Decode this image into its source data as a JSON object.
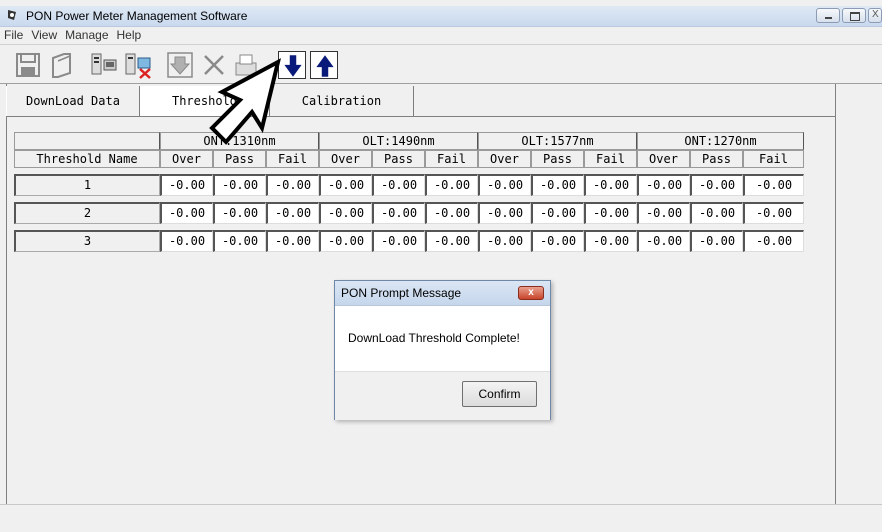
{
  "window": {
    "title": "PON Power Meter Management Software"
  },
  "menu": [
    "File",
    "View",
    "Manage",
    "Help"
  ],
  "toolbar": {
    "buttons": [
      "save-icon",
      "open-icon",
      "device-icon",
      "device-disconnect-icon",
      "download-disabled-icon",
      "delete-icon",
      "print-icon",
      "download-icon",
      "upload-icon"
    ]
  },
  "tabs": [
    "DownLoad Data",
    "Threshold",
    "Calibration"
  ],
  "table": {
    "groups": [
      "ONT:1310nm",
      "OLT:1490nm",
      "OLT:1577nm",
      "ONT:1270nm"
    ],
    "name_header": "Threshold Name",
    "subheaders": [
      "Over",
      "Pass",
      "Fail"
    ],
    "rows": [
      {
        "name": "1",
        "values": [
          "-0.00",
          "-0.00",
          "-0.00",
          "-0.00",
          "-0.00",
          "-0.00",
          "-0.00",
          "-0.00",
          "-0.00",
          "-0.00",
          "-0.00",
          "-0.00"
        ]
      },
      {
        "name": "2",
        "values": [
          "-0.00",
          "-0.00",
          "-0.00",
          "-0.00",
          "-0.00",
          "-0.00",
          "-0.00",
          "-0.00",
          "-0.00",
          "-0.00",
          "-0.00",
          "-0.00"
        ]
      },
      {
        "name": "3",
        "values": [
          "-0.00",
          "-0.00",
          "-0.00",
          "-0.00",
          "-0.00",
          "-0.00",
          "-0.00",
          "-0.00",
          "-0.00",
          "-0.00",
          "-0.00",
          "-0.00"
        ]
      }
    ]
  },
  "dialog": {
    "title": "PON Prompt Message",
    "close": "x",
    "message": "DownLoad Threshold Complete!",
    "confirm": "Confirm"
  }
}
